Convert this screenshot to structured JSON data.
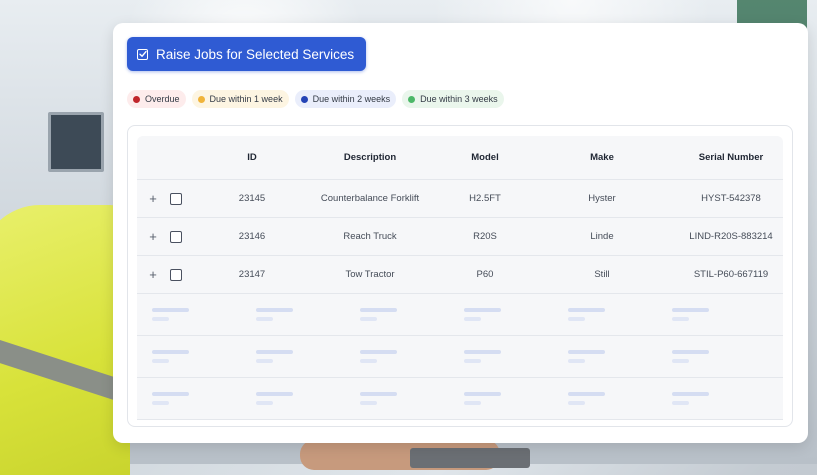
{
  "toolbar": {
    "raise_jobs_label": "Raise Jobs for Selected Services"
  },
  "legend": [
    {
      "label": "Overdue",
      "color": "#c0262b"
    },
    {
      "label": "Due within 1 week",
      "color": "#f0b43a"
    },
    {
      "label": "Due within 2 weeks",
      "color": "#2443b5"
    },
    {
      "label": "Due within 3 weeks",
      "color": "#4cb868"
    }
  ],
  "table": {
    "columns": [
      "ID",
      "Description",
      "Model",
      "Make",
      "Serial Number"
    ],
    "rows": [
      {
        "id": "23145",
        "description": "Counterbalance Forklift",
        "model": "H2.5FT",
        "make": "Hyster",
        "serial": "HYST-542378"
      },
      {
        "id": "23146",
        "description": "Reach Truck",
        "model": "R20S",
        "make": "Linde",
        "serial": "LIND-R20S-883214"
      },
      {
        "id": "23147",
        "description": "Tow Tractor",
        "model": "P60",
        "make": "Still",
        "serial": "STIL-P60-667119"
      }
    ]
  },
  "icons": {
    "raise_button": "checkbox-checked-icon",
    "row_expand": "plus-icon",
    "row_select": "checkbox-icon"
  }
}
